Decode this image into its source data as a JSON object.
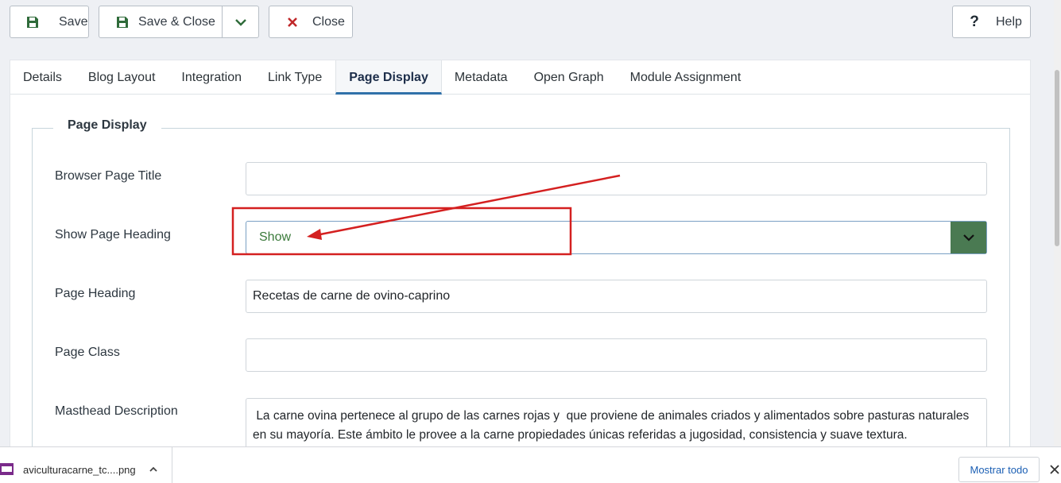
{
  "toolbar": {
    "save_label": "Save",
    "save_close_label": "Save & Close",
    "close_label": "Close",
    "help_label": "Help"
  },
  "tabs": [
    {
      "label": "Details"
    },
    {
      "label": "Blog Layout"
    },
    {
      "label": "Integration"
    },
    {
      "label": "Link Type"
    },
    {
      "label": "Page Display",
      "active": true
    },
    {
      "label": "Metadata"
    },
    {
      "label": "Open Graph"
    },
    {
      "label": "Module Assignment"
    }
  ],
  "fieldset": {
    "legend": "Page Display",
    "browser_page_title": {
      "label": "Browser Page Title",
      "value": ""
    },
    "show_page_heading": {
      "label": "Show Page Heading",
      "value": "Show"
    },
    "page_heading": {
      "label": "Page Heading",
      "value": "Recetas de carne de ovino-caprino"
    },
    "page_class": {
      "label": "Page Class",
      "value": ""
    },
    "masthead_description": {
      "label": "Masthead Description",
      "value": " La carne ovina pertenece al grupo de las carnes rojas y  que proviene de animales criados y alimentados sobre pasturas naturales en su mayoría. Este ámbito le provee a la carne propiedades únicas referidas a jugosidad, consistencia y suave textura."
    }
  },
  "downloads": {
    "file_name": "aviculturacarne_tc....png",
    "show_all_label": "Mostrar todo"
  },
  "colors": {
    "accent_tab": "#3071a9",
    "select_caret_bg": "#4a7a52",
    "annotation_red": "#d42020",
    "save_icon": "#2f6b3a",
    "close_icon": "#c0282a"
  }
}
